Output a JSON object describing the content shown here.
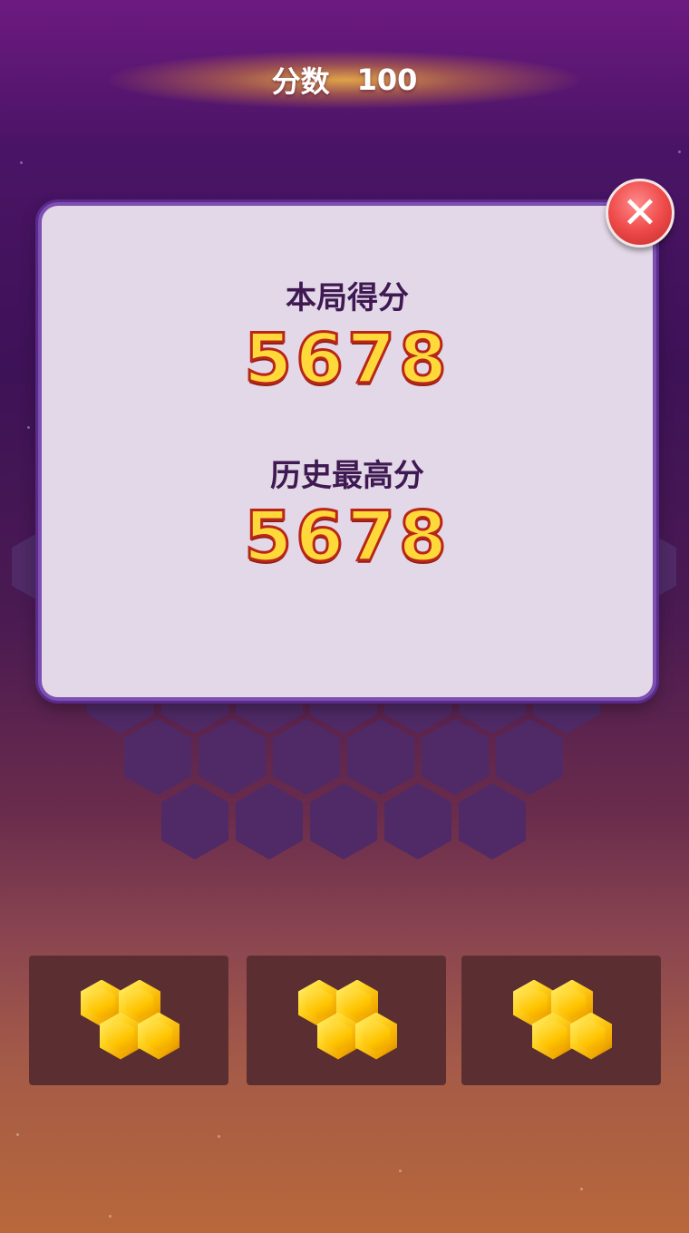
{
  "header": {
    "score_label": "分数",
    "score_value": "100"
  },
  "result_dialog": {
    "current_label": "本局得分",
    "current_score": "5678",
    "best_label": "历史最高分",
    "best_score": "5678",
    "close_icon": "close-icon"
  },
  "trays": [
    {
      "piece": "4-hex honeycomb block",
      "color": "#ffcc1a"
    },
    {
      "piece": "4-hex honeycomb block",
      "color": "#ffcc1a"
    },
    {
      "piece": "4-hex honeycomb block",
      "color": "#ffcc1a"
    }
  ],
  "colors": {
    "dialog_bg": "#e3d8e8",
    "dialog_border": "#7c4fb0",
    "score_fill": "#ffd83a",
    "score_stroke": "#b8261a",
    "empty_cell": "#4f2a66",
    "tray_bg": "#5b2f31",
    "close_button": "#ef4b4b"
  }
}
